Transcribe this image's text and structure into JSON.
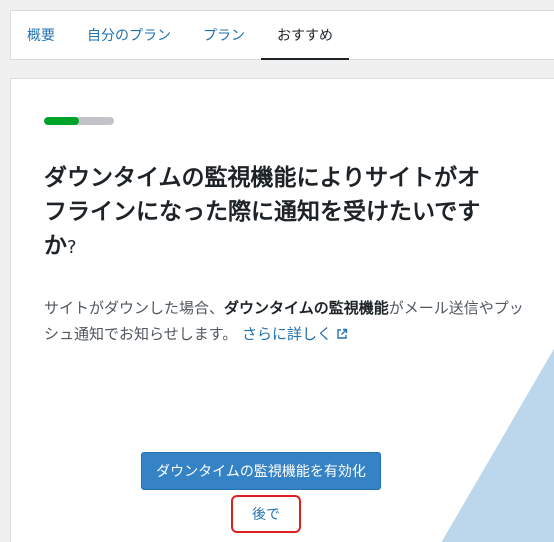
{
  "tabs": [
    {
      "label": "概要",
      "active": false
    },
    {
      "label": "自分のプラン",
      "active": false
    },
    {
      "label": "プラン",
      "active": false
    },
    {
      "label": "おすすめ",
      "active": true
    }
  ],
  "progress": {
    "fraction": 0.5
  },
  "card": {
    "title_main": "ダウンタイムの監視機能によりサイトがオフラインになった際に通知を受けたいですか",
    "title_qmark": "?",
    "desc_part1": "サイトがダウンした場合、",
    "desc_bold": "ダウンタイムの監視機能",
    "desc_part2": "がメール送信やプッシュ通知でお知らせします。",
    "learn_more": "さらに詳しく",
    "primary_button": "ダウンタイムの監視機能を有効化",
    "later_button": "後で"
  },
  "colors": {
    "accent": "#2271b1",
    "button": "#3582c4",
    "progress_fill": "#00a32a",
    "progress_track": "#c3c4c7",
    "highlight": "#e02020",
    "decor": "#bcd7ec"
  }
}
